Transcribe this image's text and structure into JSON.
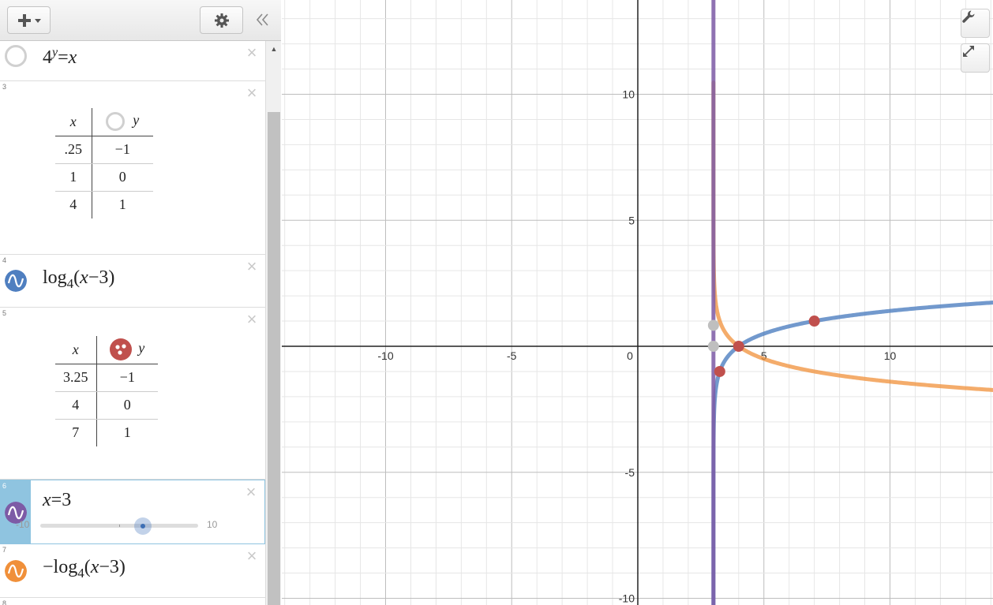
{
  "toolbar": {
    "add_icon": "plus-icon",
    "settings_icon": "gear-icon",
    "collapse_icon": "double-chevron-left-icon"
  },
  "expressions": [
    {
      "index": "",
      "math": "4^y = x",
      "icon": "hidden-circle"
    },
    {
      "index": "3",
      "type": "table",
      "headers": [
        "x",
        "y"
      ],
      "rows": [
        [
          ".25",
          "−1"
        ],
        [
          "1",
          "0"
        ],
        [
          "4",
          "1"
        ]
      ],
      "color": "#bfbfbf"
    },
    {
      "index": "4",
      "math": "log_4(x−3)",
      "color": "#4f7fc0"
    },
    {
      "index": "5",
      "type": "table",
      "headers": [
        "x",
        "y"
      ],
      "rows": [
        [
          "3.25",
          "−1"
        ],
        [
          "4",
          "0"
        ],
        [
          "7",
          "1"
        ]
      ],
      "color": "#c0504d"
    },
    {
      "index": "6",
      "math": "x = 3",
      "color": "#7d5ba6",
      "slider": {
        "min": "-10",
        "max": "10",
        "value": 3
      }
    },
    {
      "index": "7",
      "math": "−log_4(x−3)",
      "color": "#f0903a"
    },
    {
      "index": "8"
    }
  ],
  "graph_tools": {
    "wrench_icon": "wrench-icon",
    "fullscreen_icon": "expand-icon"
  },
  "chart_data": {
    "type": "line",
    "xlim": [
      -14,
      14
    ],
    "ylim": [
      -10.2,
      13.6
    ],
    "grid": true,
    "x_ticks": [
      "-10",
      "-5",
      "0",
      "5",
      "10"
    ],
    "y_ticks": [
      "10",
      "5",
      "-5",
      "-10"
    ],
    "series": [
      {
        "expr": "log4(x-3)",
        "color": "#4f7fc0"
      },
      {
        "expr": "-log4(x-3)",
        "color": "#f0903a"
      },
      {
        "expr": "x=3",
        "color": "#7d5ba6"
      }
    ],
    "points": [
      {
        "x": 3.25,
        "y": -1,
        "color": "#c0504d"
      },
      {
        "x": 4,
        "y": 0,
        "color": "#c0504d"
      },
      {
        "x": 7,
        "y": 1,
        "color": "#c0504d"
      },
      {
        "x": 3,
        "y": 0,
        "color": "#bfbfbf"
      },
      {
        "x": 3,
        "y": 0.83,
        "color": "#bfbfbf"
      }
    ]
  }
}
